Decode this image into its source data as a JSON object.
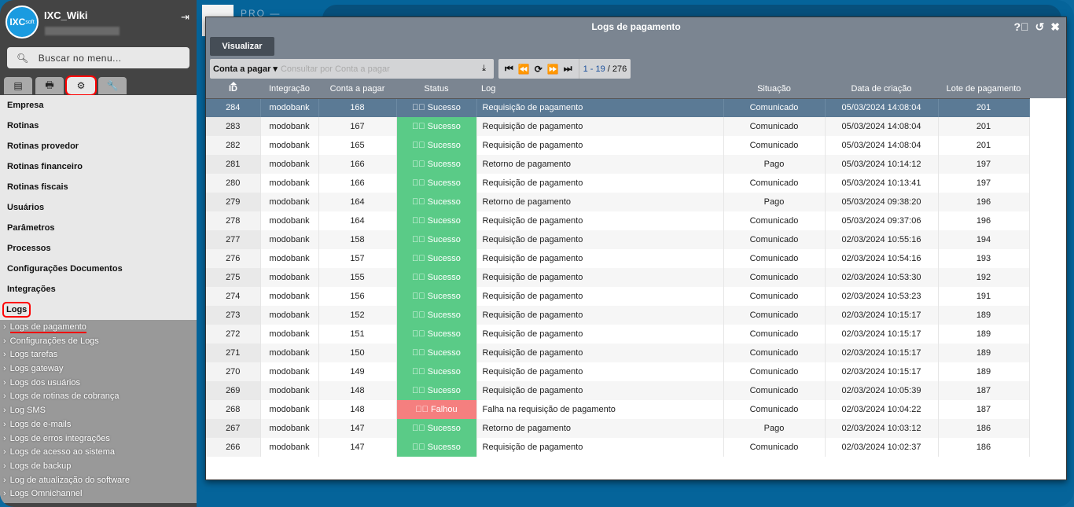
{
  "background": {
    "partial_text": "PRO —"
  },
  "sidebar": {
    "logo": "IXC",
    "logo_sub": "soft",
    "username": "IXC_Wiki",
    "search_placeholder": "Buscar no menu...",
    "tabs": [
      "list-icon",
      "printer-icon",
      "gears-icon",
      "wrench-icon"
    ],
    "menu": [
      "Empresa",
      "Rotinas",
      "Rotinas provedor",
      "Rotinas financeiro",
      "Rotinas fiscais",
      "Usuários",
      "Parâmetros",
      "Processos",
      "Configurações Documentos",
      "Integrações",
      "Logs"
    ],
    "submenu": [
      "Logs de pagamento",
      "Configurações de Logs",
      "Logs tarefas",
      "Logs gateway",
      "Logs dos usuários",
      "Logs de rotinas de cobrança",
      "Log SMS",
      "Logs de e-mails",
      "Logs de erros integrações",
      "Logs de acesso ao sistema",
      "Logs de backup",
      "Log de atualização do software",
      "Logs Omnichannel"
    ]
  },
  "modal": {
    "title": "Logs de pagamento",
    "tab": "Visualizar",
    "filter_field": "Conta a pagar",
    "filter_placeholder": "Consultar por Conta a pagar",
    "pager": {
      "range": "1 - 19",
      "total": "276"
    },
    "columns": [
      "ID",
      "Integração",
      "Conta a pagar",
      "Status",
      "Log",
      "Situação",
      "Data de criação",
      "Lote de pagamento"
    ],
    "rows": [
      [
        "284",
        "modobank",
        "168",
        "Sucesso",
        "Requisição de pagamento",
        "Comunicado",
        "05/03/2024 14:08:04",
        "201"
      ],
      [
        "283",
        "modobank",
        "167",
        "Sucesso",
        "Requisição de pagamento",
        "Comunicado",
        "05/03/2024 14:08:04",
        "201"
      ],
      [
        "282",
        "modobank",
        "165",
        "Sucesso",
        "Requisição de pagamento",
        "Comunicado",
        "05/03/2024 14:08:04",
        "201"
      ],
      [
        "281",
        "modobank",
        "166",
        "Sucesso",
        "Retorno de pagamento",
        "Pago",
        "05/03/2024 10:14:12",
        "197"
      ],
      [
        "280",
        "modobank",
        "166",
        "Sucesso",
        "Requisição de pagamento",
        "Comunicado",
        "05/03/2024 10:13:41",
        "197"
      ],
      [
        "279",
        "modobank",
        "164",
        "Sucesso",
        "Retorno de pagamento",
        "Pago",
        "05/03/2024 09:38:20",
        "196"
      ],
      [
        "278",
        "modobank",
        "164",
        "Sucesso",
        "Requisição de pagamento",
        "Comunicado",
        "05/03/2024 09:37:06",
        "196"
      ],
      [
        "277",
        "modobank",
        "158",
        "Sucesso",
        "Requisição de pagamento",
        "Comunicado",
        "02/03/2024 10:55:16",
        "194"
      ],
      [
        "276",
        "modobank",
        "157",
        "Sucesso",
        "Requisição de pagamento",
        "Comunicado",
        "02/03/2024 10:54:16",
        "193"
      ],
      [
        "275",
        "modobank",
        "155",
        "Sucesso",
        "Requisição de pagamento",
        "Comunicado",
        "02/03/2024 10:53:30",
        "192"
      ],
      [
        "274",
        "modobank",
        "156",
        "Sucesso",
        "Requisição de pagamento",
        "Comunicado",
        "02/03/2024 10:53:23",
        "191"
      ],
      [
        "273",
        "modobank",
        "152",
        "Sucesso",
        "Requisição de pagamento",
        "Comunicado",
        "02/03/2024 10:15:17",
        "189"
      ],
      [
        "272",
        "modobank",
        "151",
        "Sucesso",
        "Requisição de pagamento",
        "Comunicado",
        "02/03/2024 10:15:17",
        "189"
      ],
      [
        "271",
        "modobank",
        "150",
        "Sucesso",
        "Requisição de pagamento",
        "Comunicado",
        "02/03/2024 10:15:17",
        "189"
      ],
      [
        "270",
        "modobank",
        "149",
        "Sucesso",
        "Requisição de pagamento",
        "Comunicado",
        "02/03/2024 10:15:17",
        "189"
      ],
      [
        "269",
        "modobank",
        "148",
        "Sucesso",
        "Requisição de pagamento",
        "Comunicado",
        "02/03/2024 10:05:39",
        "187"
      ],
      [
        "268",
        "modobank",
        "148",
        "Falhou",
        "Falha na requisição de pagamento",
        "Comunicado",
        "02/03/2024 10:04:22",
        "187"
      ],
      [
        "267",
        "modobank",
        "147",
        "Sucesso",
        "Retorno de pagamento",
        "Pago",
        "02/03/2024 10:03:12",
        "186"
      ],
      [
        "266",
        "modobank",
        "147",
        "Sucesso",
        "Requisição de pagamento",
        "Comunicado",
        "02/03/2024 10:02:37",
        "186"
      ]
    ]
  },
  "colors": {
    "success": "#5acb87",
    "failure": "#f57f7f",
    "selected_row": "#5b7a95",
    "header": "#7b8591"
  }
}
